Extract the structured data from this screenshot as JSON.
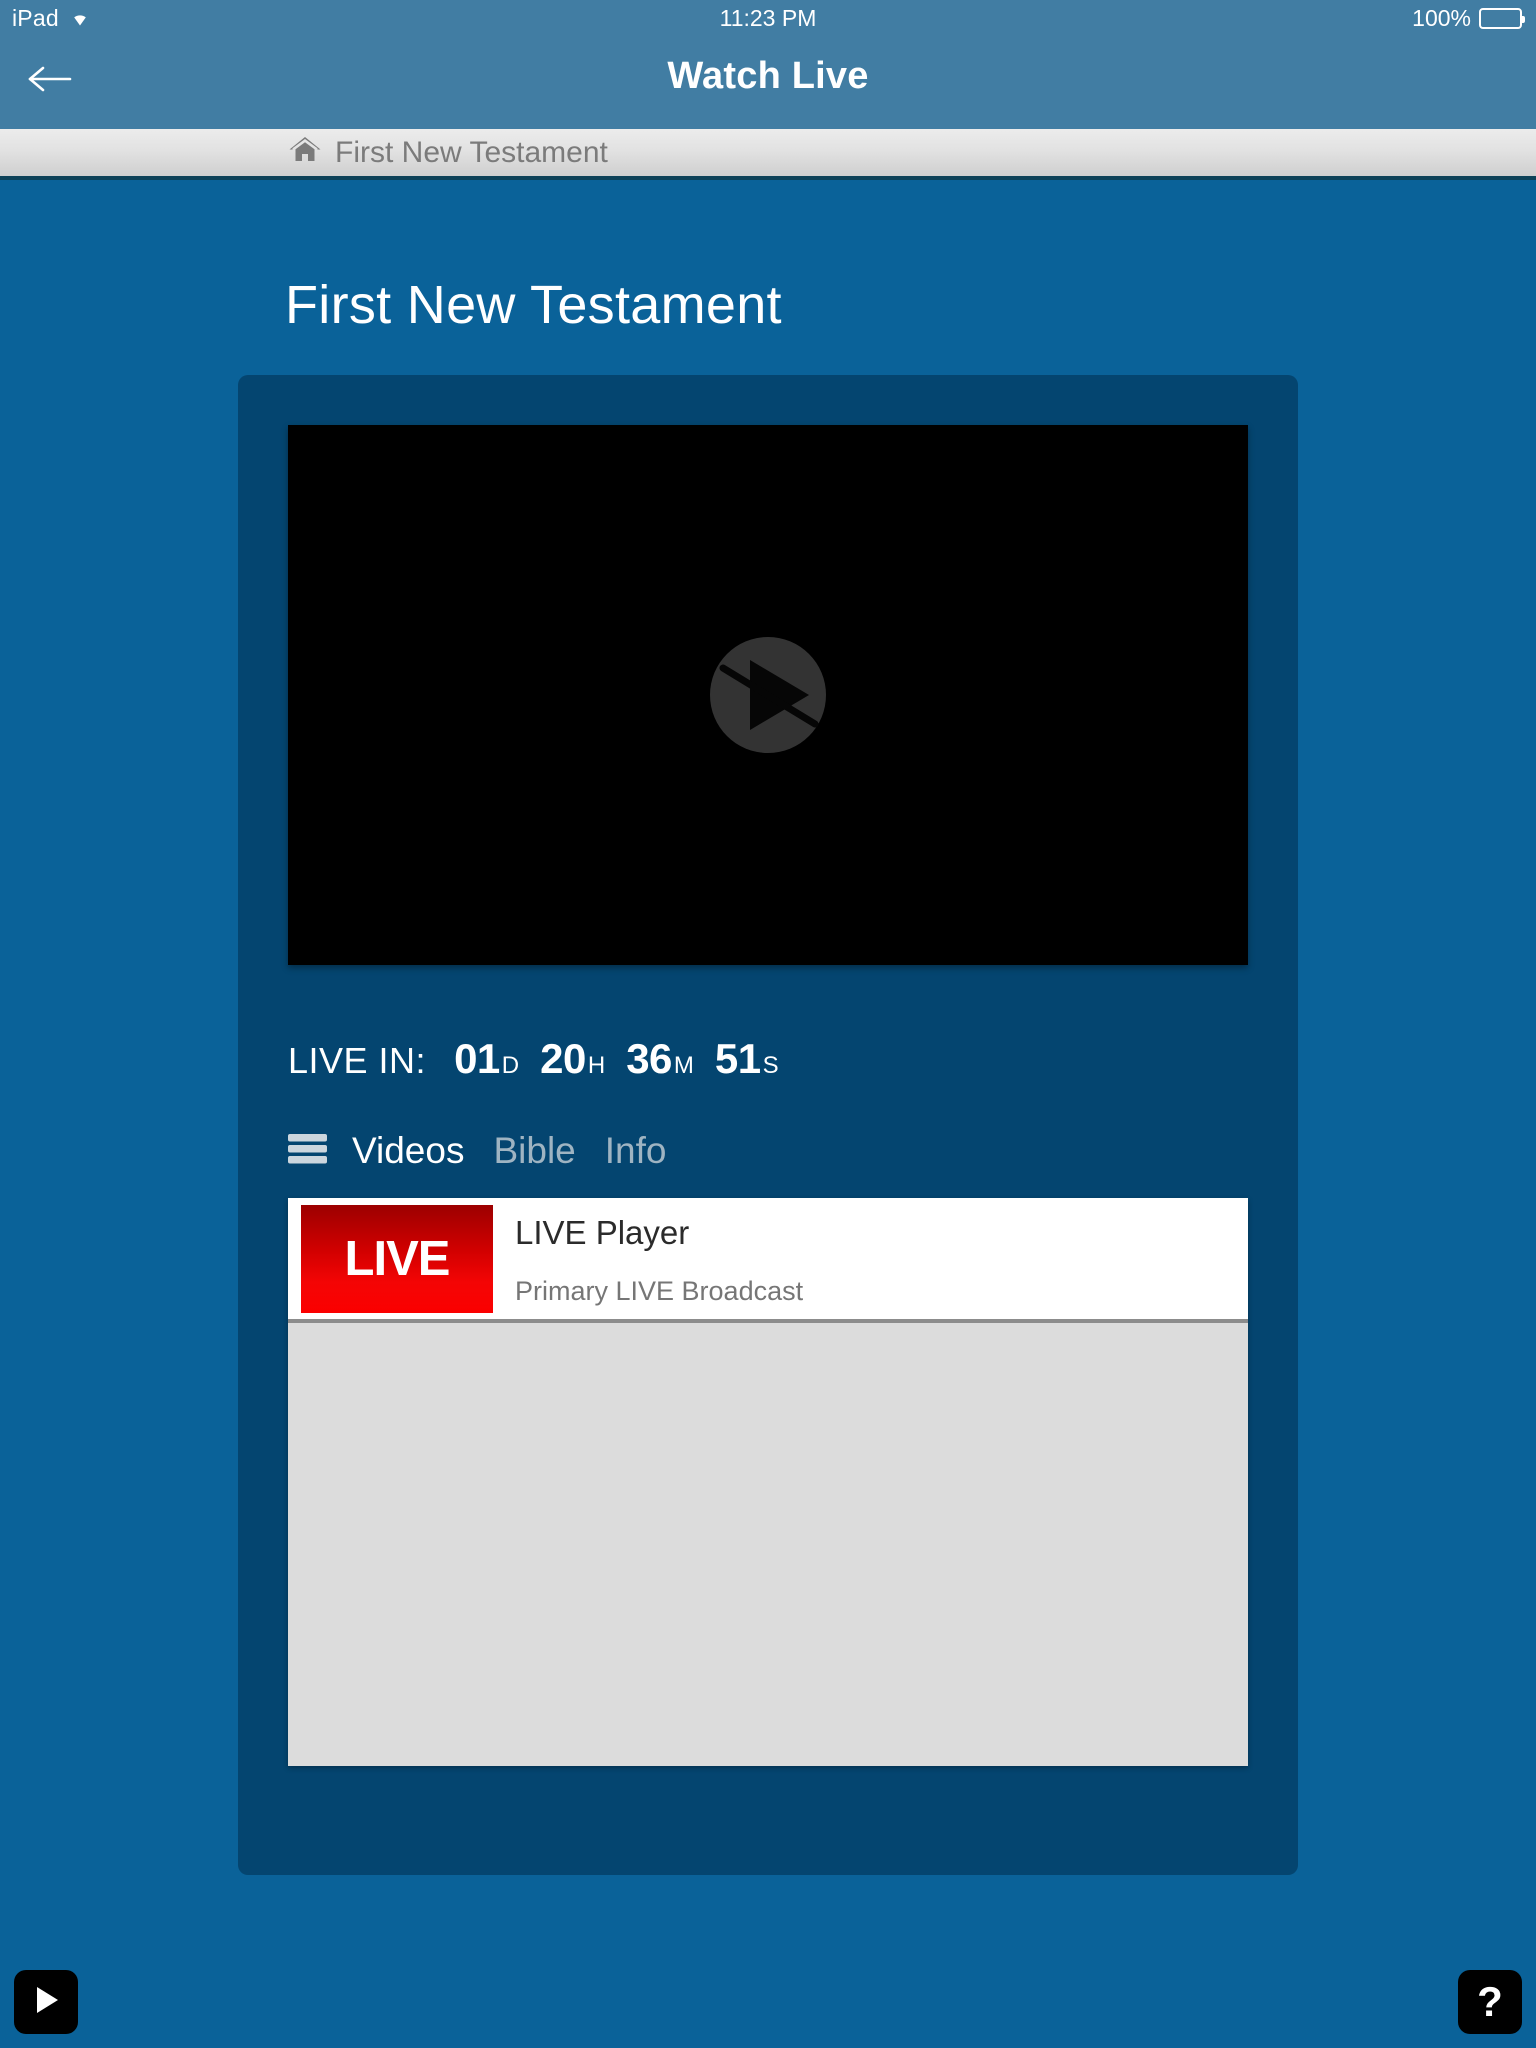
{
  "status_bar": {
    "device": "iPad",
    "wifi_icon": "wifi-icon",
    "time": "11:23 PM",
    "battery_percent": "100%",
    "battery_icon": "battery-icon"
  },
  "nav_bar": {
    "back_icon": "arrow-left-icon",
    "title": "Watch Live"
  },
  "breadcrumb": {
    "home_icon": "home-icon",
    "label": "First New Testament"
  },
  "main": {
    "page_title": "First New Testament",
    "video_player": {
      "play_icon": "play-disabled-icon",
      "state": "unavailable"
    },
    "countdown": {
      "label": "LIVE IN:",
      "units": [
        {
          "value": "01",
          "suffix": "D"
        },
        {
          "value": "20",
          "suffix": "H"
        },
        {
          "value": "36",
          "suffix": "M"
        },
        {
          "value": "51",
          "suffix": "S"
        }
      ]
    },
    "tabs": {
      "menu_icon": "hamburger-menu-icon",
      "items": [
        {
          "label": "Videos",
          "active": true
        },
        {
          "label": "Bible",
          "active": false
        },
        {
          "label": "Info",
          "active": false
        }
      ]
    },
    "video_list": [
      {
        "thumbnail_label": "LIVE",
        "title": "LIVE Player",
        "subtitle": "Primary LIVE Broadcast"
      }
    ]
  },
  "floating_buttons": {
    "play": {
      "icon": "play-icon",
      "name": "play-button"
    },
    "help": {
      "icon": "question-mark-icon",
      "label": "?"
    }
  },
  "colors": {
    "status_bar": "#417da3",
    "nav_bar": "#417da3",
    "page_background": "#0a6299",
    "card_background": "#044570",
    "accent_red": "#e00000",
    "list_background": "#dcdcdc"
  }
}
